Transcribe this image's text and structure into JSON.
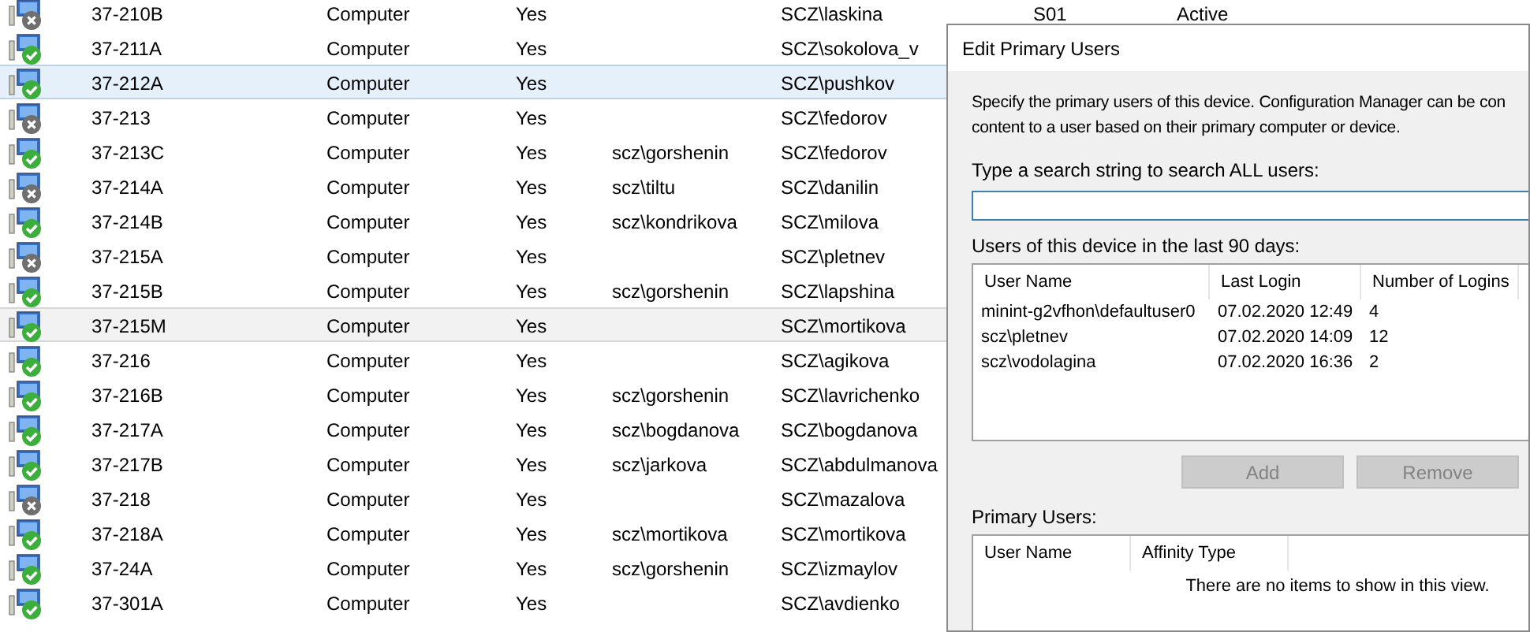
{
  "devices": {
    "rows": [
      {
        "kind": "error",
        "name": "37-210B",
        "type": "Computer",
        "client": "Yes",
        "column_4": "",
        "column_5": "SCZ\\laskina",
        "column_6": "S01",
        "column_7": "Active",
        "selected": false
      },
      {
        "kind": "ok",
        "name": "37-211A",
        "type": "Computer",
        "client": "Yes",
        "column_4": "",
        "column_5": "SCZ\\sokolova_v",
        "selected": false
      },
      {
        "kind": "ok",
        "name": "37-212A",
        "type": "Computer",
        "client": "Yes",
        "column_4": "",
        "column_5": "SCZ\\pushkov",
        "selected": true
      },
      {
        "kind": "error",
        "name": "37-213",
        "type": "Computer",
        "client": "Yes",
        "column_4": "",
        "column_5": "SCZ\\fedorov",
        "selected": false
      },
      {
        "kind": "ok",
        "name": "37-213C",
        "type": "Computer",
        "client": "Yes",
        "column_4": "scz\\gorshenin",
        "column_5": "SCZ\\fedorov",
        "selected": false
      },
      {
        "kind": "error",
        "name": "37-214A",
        "type": "Computer",
        "client": "Yes",
        "column_4": "scz\\tiltu",
        "column_5": "SCZ\\danilin",
        "selected": false
      },
      {
        "kind": "ok",
        "name": "37-214B",
        "type": "Computer",
        "client": "Yes",
        "column_4": "scz\\kondrikova",
        "column_5": "SCZ\\milova",
        "selected": false
      },
      {
        "kind": "error",
        "name": "37-215A",
        "type": "Computer",
        "client": "Yes",
        "column_4": "",
        "column_5": "SCZ\\pletnev",
        "selected": false
      },
      {
        "kind": "ok",
        "name": "37-215B",
        "type": "Computer",
        "client": "Yes",
        "column_4": "scz\\gorshenin",
        "column_5": "SCZ\\lapshina",
        "selected": false
      },
      {
        "kind": "ok",
        "name": "37-215M",
        "type": "Computer",
        "client": "Yes",
        "column_4": "",
        "column_5": "SCZ\\mortikova",
        "selected": true,
        "focused": false
      },
      {
        "kind": "ok",
        "name": "37-216",
        "type": "Computer",
        "client": "Yes",
        "column_4": "",
        "column_5": "SCZ\\agikova",
        "selected": false
      },
      {
        "kind": "ok",
        "name": "37-216B",
        "type": "Computer",
        "client": "Yes",
        "column_4": "scz\\gorshenin",
        "column_5": "SCZ\\lavrichenko",
        "selected": false
      },
      {
        "kind": "ok",
        "name": "37-217A",
        "type": "Computer",
        "client": "Yes",
        "column_4": "scz\\bogdanova",
        "column_5": "SCZ\\bogdanova",
        "selected": false
      },
      {
        "kind": "ok",
        "name": "37-217B",
        "type": "Computer",
        "client": "Yes",
        "column_4": "scz\\jarkova",
        "column_5": "SCZ\\abdulmanova",
        "selected": false
      },
      {
        "kind": "error",
        "name": "37-218",
        "type": "Computer",
        "client": "Yes",
        "column_4": "",
        "column_5": "SCZ\\mazalova",
        "selected": false
      },
      {
        "kind": "ok",
        "name": "37-218A",
        "type": "Computer",
        "client": "Yes",
        "column_4": "scz\\mortikova",
        "column_5": "SCZ\\mortikova",
        "selected": false
      },
      {
        "kind": "ok",
        "name": "37-24A",
        "type": "Computer",
        "client": "Yes",
        "column_4": "scz\\gorshenin",
        "column_5": "SCZ\\izmaylov",
        "selected": false
      },
      {
        "kind": "ok",
        "name": "37-301A",
        "type": "Computer",
        "client": "Yes",
        "column_4": "",
        "column_5": "SCZ\\avdienko",
        "selected": false
      }
    ]
  },
  "dialog": {
    "title": "Edit Primary Users",
    "description_lines": [
      "Specify the primary users of this device. Configuration Manager can be con",
      "content to a user based on their primary computer or device."
    ],
    "search_label": "Type a search string to search ALL users:",
    "recent_label": "Users of this device in the last 90 days:",
    "recent_users": {
      "columns": [
        "User Name",
        "Last Login",
        "Number of Logins"
      ],
      "rows": [
        [
          "minint-g2vfhon\\defaultuser0",
          "07.02.2020 12:49",
          "4"
        ],
        [
          "scz\\pletnev",
          "07.02.2020 14:09",
          "12"
        ],
        [
          "scz\\vodolagina",
          "07.02.2020 16:36",
          "2"
        ]
      ]
    },
    "buttons": [
      {
        "label": "Add",
        "disabled": true
      },
      {
        "label": "Remove",
        "disabled": true
      }
    ],
    "primary_label": "Primary Users:",
    "primary_users": {
      "columns": [
        "User Name",
        "Affinity Type"
      ],
      "empty_text": "There are no items to show in this view."
    }
  }
}
